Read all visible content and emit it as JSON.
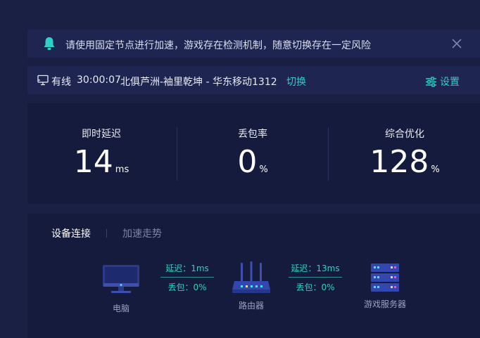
{
  "notice": {
    "text": "请使用固定节点进行加速，游戏存在检测机制，随意切换存在一定风险"
  },
  "status": {
    "online_label": "有线",
    "timer": "30:00:07",
    "node": "北俱芦洲-袖里乾坤 - 华东移动1312",
    "switch_label": "切换",
    "settings_label": "设置"
  },
  "metrics": {
    "latency": {
      "label": "即时延迟",
      "value": "14",
      "unit": "ms"
    },
    "loss": {
      "label": "丢包率",
      "value": "0",
      "unit": "%"
    },
    "optimization": {
      "label": "综合优化",
      "value": "128",
      "unit": "%"
    }
  },
  "devices": {
    "tabs": [
      "设备连接",
      "加速走势"
    ],
    "computer_label": "电脑",
    "router_label": "路由器",
    "server_label": "游戏服务器",
    "link1": {
      "latency": "延迟：1ms",
      "loss": "丢包：0%"
    },
    "link2": {
      "latency": "延迟：13ms",
      "loss": "丢包：0%"
    }
  },
  "colors": {
    "background": "#1a2044",
    "panel": "#1d2550",
    "accent": "#2fd0c6"
  }
}
